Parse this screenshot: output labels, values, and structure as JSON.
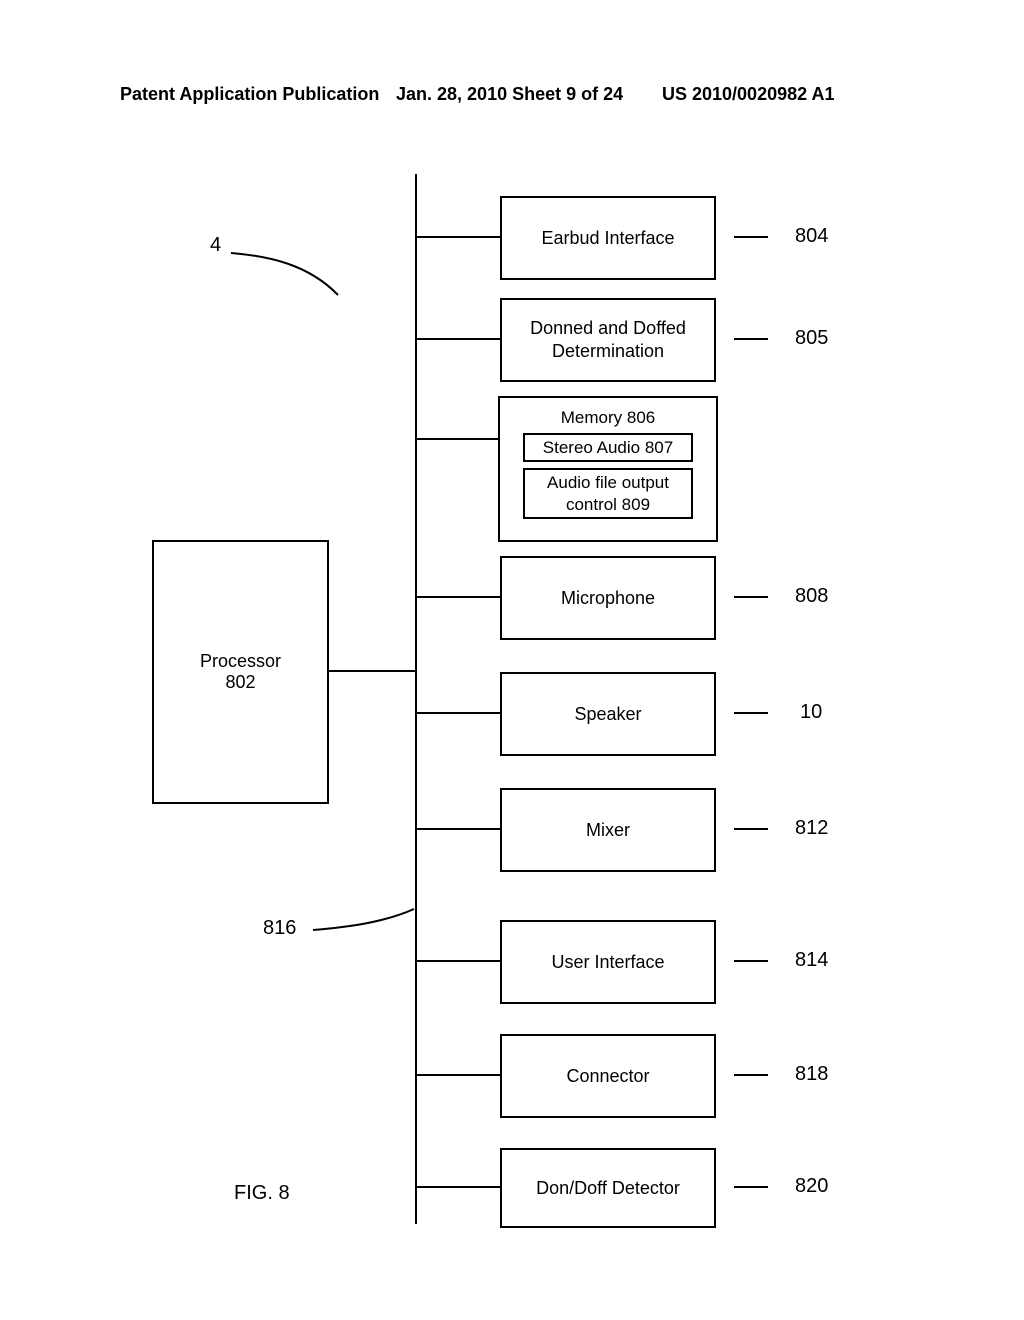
{
  "header": {
    "left": "Patent Application Publication",
    "mid": "Jan. 28, 2010  Sheet 9 of 24",
    "right": "US 2010/0020982 A1"
  },
  "figure_label": "FIG. 8",
  "processor": {
    "name": "Processor",
    "num": "802"
  },
  "blocks": {
    "earbud": {
      "label": "Earbud Interface",
      "ref": "804"
    },
    "donned": {
      "label": "Donned and Doffed\nDetermination",
      "ref": "805"
    },
    "memory": {
      "label": "Memory 806",
      "inner1": "Stereo Audio 807",
      "inner2": "Audio file output\ncontrol 809"
    },
    "mic": {
      "label": "Microphone",
      "ref": "808"
    },
    "spk": {
      "label": "Speaker",
      "ref": "10"
    },
    "mixer": {
      "label": "Mixer",
      "ref": "812"
    },
    "ui": {
      "label": "User Interface",
      "ref": "814"
    },
    "conn": {
      "label": "Connector",
      "ref": "818"
    },
    "det": {
      "label": "Don/Doff Detector",
      "ref": "820"
    }
  },
  "leads": {
    "fig_ref": "4",
    "bus_ref": "816"
  }
}
